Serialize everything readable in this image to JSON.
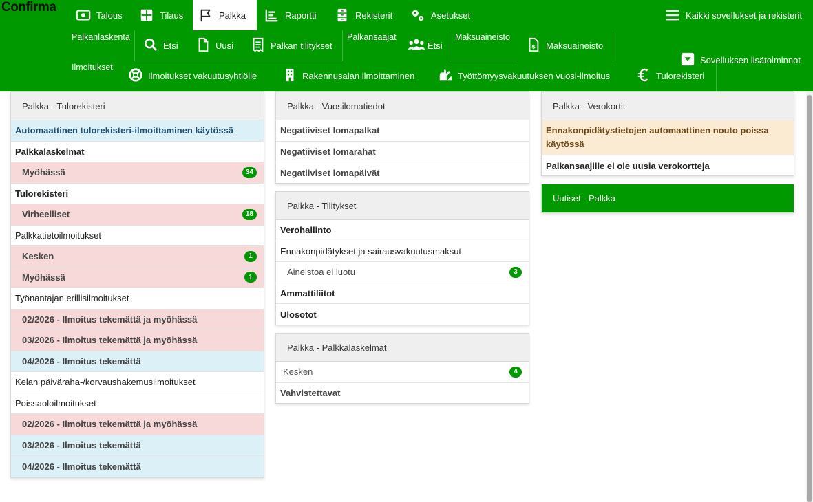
{
  "app": {
    "logo": "Confirma"
  },
  "nav": [
    {
      "label": "Talous",
      "icon": "money-icon"
    },
    {
      "label": "Tilaus",
      "icon": "grid-icon"
    },
    {
      "label": "Palkka",
      "icon": "flag-icon"
    },
    {
      "label": "Raportti",
      "icon": "report-icon"
    },
    {
      "label": "Rekisterit",
      "icon": "cabinet-icon"
    },
    {
      "label": "Asetukset",
      "icon": "gears-icon"
    }
  ],
  "nav_right": {
    "all_apps": "Kaikki sovellukset ja rekisterit",
    "extra_info": "Sovelluksen lisätoiminnot"
  },
  "submenu": {
    "palkanlaskenta": {
      "label": "Palkanlaskenta",
      "etsi": "Etsi",
      "uusi": "Uusi",
      "tilitykset": "Palkan tilitykset"
    },
    "palkansaajat": {
      "label": "Palkansaajat",
      "etsi": "Etsi"
    },
    "maksuaineisto": {
      "label": "Maksuaineisto",
      "item": "Maksuaineisto"
    },
    "ilmoitukset": {
      "label": "Ilmoitukset",
      "vakuutus": "Ilmoitukset vakuutusyhtiölle",
      "rakennus": "Rakennusalan ilmoittaminen",
      "tyottomyys": "Työttömyysvakuutuksen vuosi-ilmoitus",
      "tulorekisteri": "Tulorekisteri"
    }
  },
  "tulorekisteri_panel": {
    "title": "Palkka - Tulorekisteri",
    "auto": "Automaattinen tulorekisteri-ilmoittaminen käytössä",
    "palkkalaskelmat": "Palkkalaskelmat",
    "myohassa": "Myöhässä",
    "myohassa_count": "34",
    "tulorekisteri": "Tulorekisteri",
    "virheelliset": "Virheelliset",
    "virheelliset_count": "18",
    "palkkatieto": "Palkkatietoilmoitukset",
    "kesken": "Kesken",
    "kesken_count": "1",
    "myohassa2": "Myöhässä",
    "myohassa2_count": "1",
    "erillis": "Työnantajan erillisilmoitukset",
    "e1": "02/2026 - Ilmoitus tekemättä ja myöhässä",
    "e2": "03/2026 - Ilmoitus tekemättä ja myöhässä",
    "e3": "04/2026 - Ilmoitus tekemättä",
    "kela": "Kelan päiväraha-/korvaushakemusilmoitukset",
    "poissa": "Poissaoloilmoitukset",
    "p1": "02/2026 - Ilmoitus tekemättä ja myöhässä",
    "p2": "03/2026 - Ilmoitus tekemättä",
    "p3": "04/2026 - Ilmoitus tekemättä"
  },
  "vuosiloma_panel": {
    "title": "Palkka - Vuosilomatiedot",
    "r1": "Negatiiviset lomapalkat",
    "r2": "Negatiiviset lomarahat",
    "r3": "Negatiiviset lomapäivät"
  },
  "tilitykset_panel": {
    "title": "Palkka - Tilitykset",
    "vero": "Verohallinto",
    "ennakko": "Ennakonpidätykset ja sairausvakuutusmaksut",
    "aineisto": "Aineistoa ei luotu",
    "aineisto_count": "3",
    "ammatti": "Ammattiliitot",
    "ulosotot": "Ulosotot"
  },
  "palkkalaskelmat_panel": {
    "title": "Palkka - Palkkalaskelmat",
    "kesken": "Kesken",
    "kesken_count": "4",
    "vahvist": "Vahvistettavat"
  },
  "verokortit_panel": {
    "title": "Palkka - Verokortit",
    "notice": "Ennakonpidätystietojen automaattinen nouto poissa käytössä",
    "none": "Palkansaajille ei ole uusia verokortteja"
  },
  "uutiset_panel": {
    "title": "Uutiset - Palkka"
  },
  "colors": {
    "brand_green": "#009900",
    "red_row": "#f8d9d9",
    "blue_row": "#dcf0f8",
    "cream_row": "#fcebd3"
  }
}
